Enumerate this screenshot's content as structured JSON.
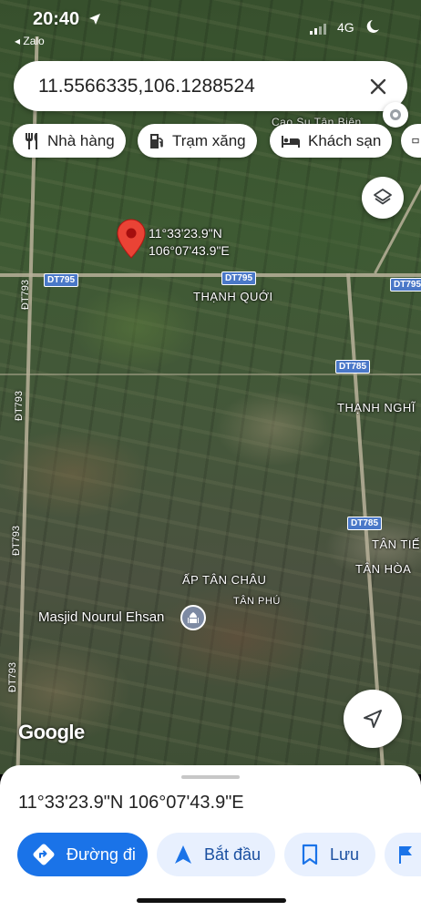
{
  "status_bar": {
    "time": "20:40",
    "back_app": "◂ Zalo",
    "network": "4G"
  },
  "search": {
    "value": "11.5566335,106.1288524"
  },
  "chips": [
    {
      "label": "Nhà hàng",
      "icon": "restaurant-icon"
    },
    {
      "label": "Trạm xăng",
      "icon": "gas-station-icon"
    },
    {
      "label": "Khách sạn",
      "icon": "hotel-icon"
    }
  ],
  "map": {
    "pin_label_line1": "11°33'23.9\"N",
    "pin_label_line2": "106°07'43.9\"E",
    "place_labels": {
      "thanh_quoi": "THẠNH QUỚI",
      "thanh_nghi": "THẠNH NGHĨ",
      "tan_tie": "TÂN TIẾ",
      "tan_hoa": "TÂN HÒA",
      "ap_tan_chau": "ẤP TÂN CHÂU",
      "tan_phu": "TÂN PHÚ",
      "cao_su": "Cao Su Tân Biên",
      "masjid": "Masjid Nourul Ehsan"
    },
    "road_shields": {
      "dt795_left": "DT795",
      "dt795_mid": "DT795",
      "dt795_right": "DT795",
      "dt785_upper": "DT785",
      "dt785_lower": "DT785"
    },
    "vertical_road_labels": {
      "dt793_a": "ĐT793",
      "dt793_b": "ĐT793",
      "dt793_c": "ĐT793",
      "dt793_d": "ĐT793"
    },
    "logo": "Google"
  },
  "sheet": {
    "title": "11°33'23.9\"N 106°07'43.9\"E",
    "actions": [
      {
        "label": "Đường đi",
        "icon": "directions-icon",
        "primary": true
      },
      {
        "label": "Bắt đầu",
        "icon": "navigation-arrow-icon",
        "primary": false
      },
      {
        "label": "Lưu",
        "icon": "bookmark-icon",
        "primary": false
      }
    ]
  },
  "colors": {
    "primary_blue": "#1a73e8",
    "chip_bg": "#ffffff",
    "pin_red": "#ea4335",
    "secondary_btn_bg": "#e8f0fe"
  }
}
